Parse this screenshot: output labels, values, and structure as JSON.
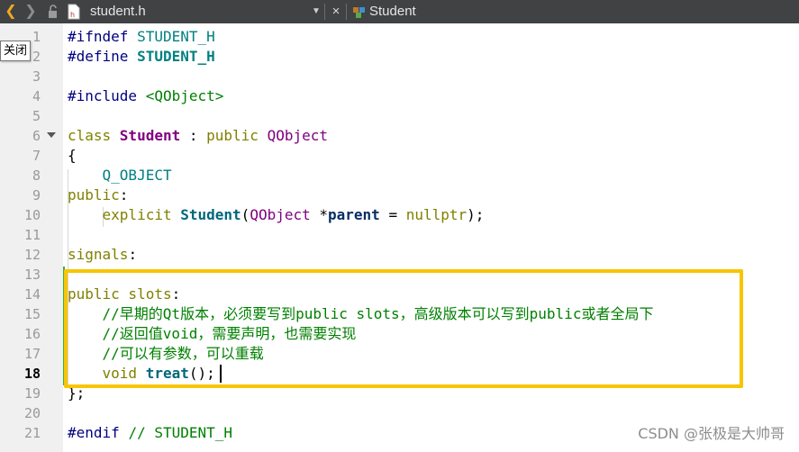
{
  "tabbar": {
    "back_icon": "chevron-left-icon",
    "forward_icon": "chevron-right-icon",
    "lock_icon": "unlocked-icon",
    "file_name": "student.h",
    "close_glyph": "×",
    "class_name": "Student"
  },
  "tooltip": {
    "text": "关闭"
  },
  "editor": {
    "current_line": 18,
    "line_numbers": [
      "1",
      "2",
      "3",
      "4",
      "5",
      "6",
      "7",
      "8",
      "9",
      "10",
      "11",
      "12",
      "13",
      "14",
      "15",
      "16",
      "17",
      "18",
      "19",
      "20",
      "21"
    ],
    "lines": [
      [
        {
          "t": "#ifndef ",
          "c": "pp"
        },
        {
          "t": "STUDENT_H",
          "c": "mac"
        }
      ],
      [
        {
          "t": "#define ",
          "c": "pp"
        },
        {
          "t": "STUDENT_H",
          "c": "mac-b"
        }
      ],
      [],
      [
        {
          "t": "#include ",
          "c": "pp"
        },
        {
          "t": "<QObject>",
          "c": "inc"
        }
      ],
      [],
      [
        {
          "t": "class ",
          "c": "kw"
        },
        {
          "t": "Student",
          "c": "cls"
        },
        {
          "t": " : ",
          "c": ""
        },
        {
          "t": "public ",
          "c": "kw"
        },
        {
          "t": "QObject",
          "c": "typ"
        }
      ],
      [
        {
          "t": "{",
          "c": ""
        }
      ],
      [
        {
          "t": "    Q_OBJECT",
          "c": "mac"
        }
      ],
      [
        {
          "t": "public",
          "c": "kw"
        },
        {
          "t": ":",
          "c": ""
        }
      ],
      [
        {
          "t": "    explicit ",
          "c": "kw"
        },
        {
          "t": "Student",
          "c": "fn"
        },
        {
          "t": "(",
          "c": ""
        },
        {
          "t": "QObject",
          "c": "typ"
        },
        {
          "t": " *",
          "c": ""
        },
        {
          "t": "parent",
          "c": "param"
        },
        {
          "t": " = ",
          "c": ""
        },
        {
          "t": "nullptr",
          "c": "kw"
        },
        {
          "t": ");",
          "c": ""
        }
      ],
      [],
      [
        {
          "t": "signals",
          "c": "kw"
        },
        {
          "t": ":",
          "c": ""
        }
      ],
      [],
      [
        {
          "t": "public slots",
          "c": "kw"
        },
        {
          "t": ":",
          "c": ""
        }
      ],
      [
        {
          "t": "    //早期的Qt版本，必须要写到public slots，高级版本可以写到public或者全局下",
          "c": "cmt"
        }
      ],
      [
        {
          "t": "    //返回值void，需要声明，也需要实现",
          "c": "cmt"
        }
      ],
      [
        {
          "t": "    //可以有参数，可以重载",
          "c": "cmt"
        }
      ],
      [
        {
          "t": "    void ",
          "c": "kw"
        },
        {
          "t": "treat",
          "c": "fn"
        },
        {
          "t": "();",
          "c": ""
        }
      ],
      [
        {
          "t": "};",
          "c": ""
        }
      ],
      [],
      [
        {
          "t": "#endif ",
          "c": "pp"
        },
        {
          "t": "// STUDENT_H",
          "c": "cmt"
        }
      ]
    ]
  },
  "watermark": {
    "text": "CSDN @张极是大帅哥"
  },
  "colors": {
    "tabbar_bg": "#404244",
    "gutter_bg": "#f0f0f0",
    "highlight_border": "#f7c600",
    "keyword": "#808000",
    "comment": "#008000",
    "class": "#800080"
  }
}
